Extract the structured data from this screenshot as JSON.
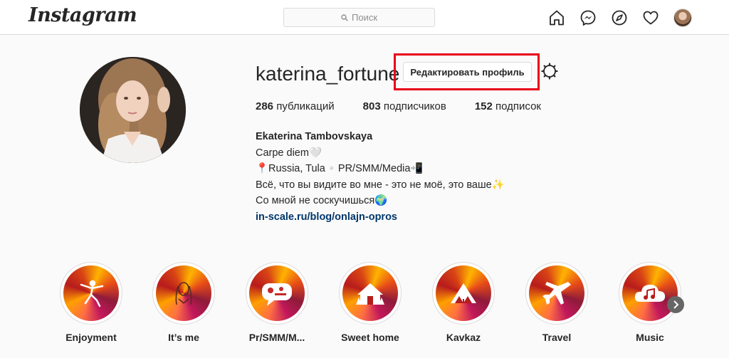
{
  "header": {
    "logo": "Instagram",
    "search_placeholder": "Поиск",
    "icons": [
      "home-icon",
      "messenger-icon",
      "explore-icon",
      "heart-icon",
      "profile-avatar"
    ]
  },
  "profile": {
    "username": "katerina_fortune",
    "edit_button": "Редактировать профиль",
    "stats": {
      "posts_count": "286",
      "posts_label": "публикаций",
      "followers_count": "803",
      "followers_label": "подписчиков",
      "following_count": "152",
      "following_label": "подписок"
    },
    "bio": {
      "name": "Ekaterina Tambovskaya",
      "line1": "Carpe diem🤍",
      "line2": "📍Russia, Tula▫️PR/SMM/Media📲",
      "line3": "Всё, что вы видите во мне - это не моё, это ваше✨",
      "line4": "Со мной не соскучишься🌍",
      "link": "in-scale.ru/blog/onlajn-opros"
    }
  },
  "highlights": [
    {
      "label": "Enjoyment",
      "icon": "dancer-icon"
    },
    {
      "label": "It’s me",
      "icon": "portrait-sketch-icon"
    },
    {
      "label": "Pr/SMM/M...",
      "icon": "chat-bubble-icon"
    },
    {
      "label": "Sweet home",
      "icon": "house-icon"
    },
    {
      "label": "Kavkaz",
      "icon": "mountain-icon"
    },
    {
      "label": "Travel",
      "icon": "airplane-icon"
    },
    {
      "label": "Music",
      "icon": "music-cloud-icon"
    }
  ],
  "colors": {
    "background": "#fafafa",
    "highlight_box": "#e8001a",
    "link": "#00376b"
  }
}
